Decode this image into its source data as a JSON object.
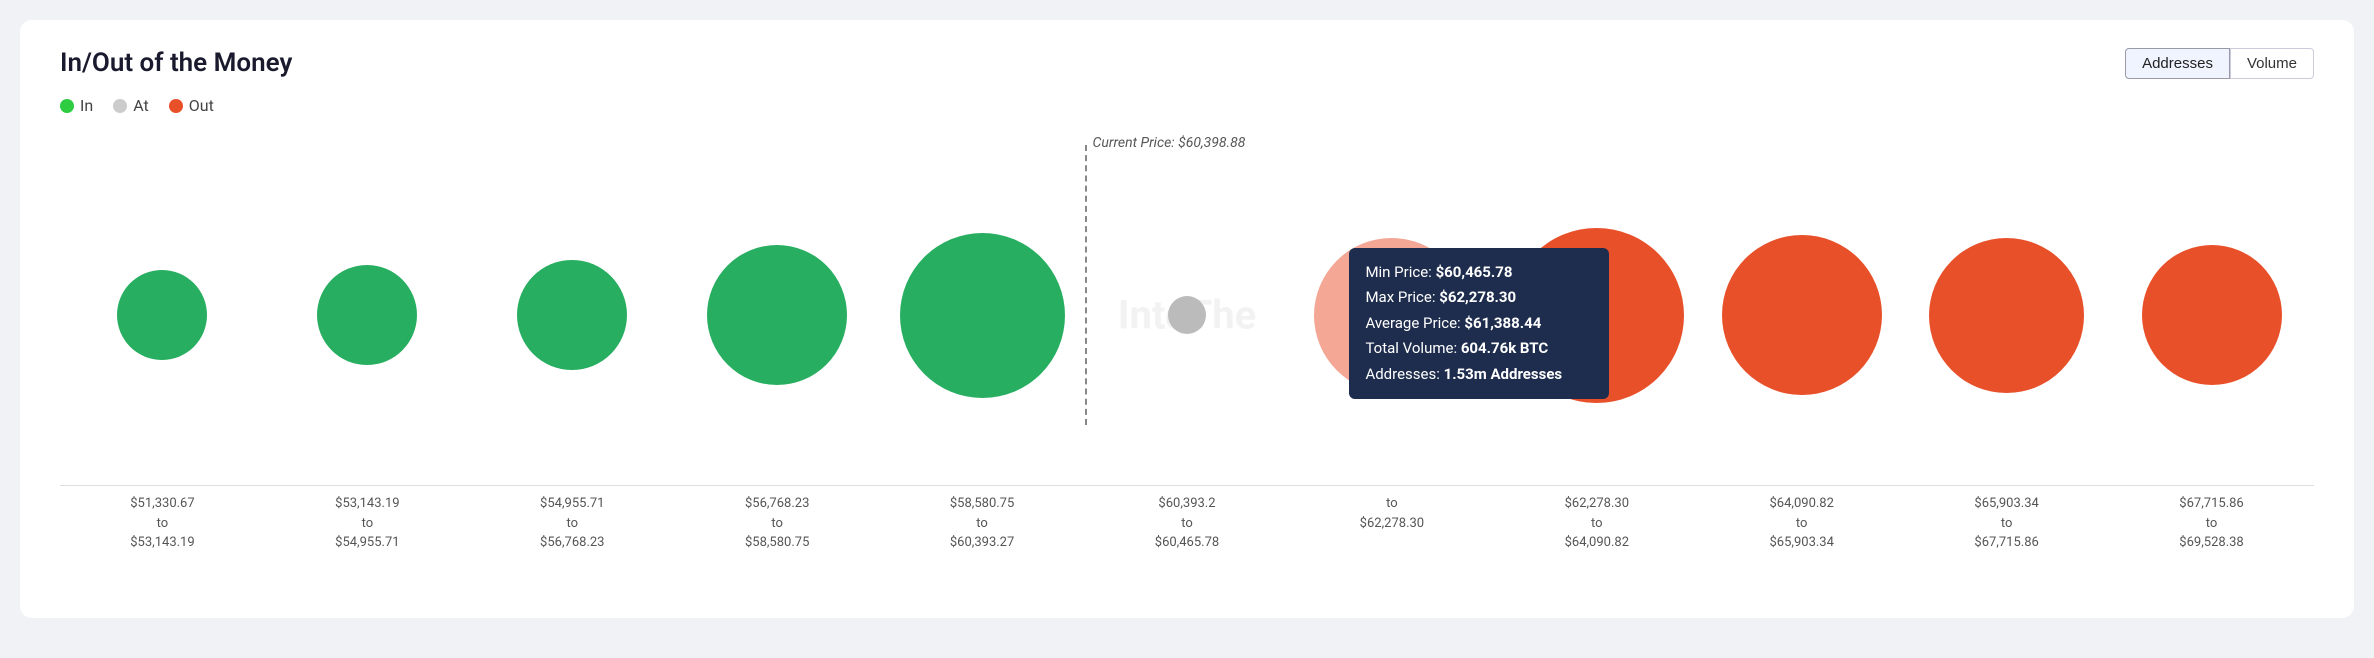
{
  "title": "In/Out of the Money",
  "legend": {
    "in_label": "In",
    "at_label": "At",
    "out_label": "Out"
  },
  "buttons": {
    "addresses_label": "Addresses",
    "volume_label": "Volume",
    "active": "Addresses"
  },
  "current_price": {
    "label": "Current Price: $60,398.88",
    "value": "$60,398.88"
  },
  "tooltip": {
    "min_price_label": "Min Price:",
    "min_price_value": "$60,465.78",
    "max_price_label": "Max Price:",
    "max_price_value": "$62,278.30",
    "avg_price_label": "Average Price:",
    "avg_price_value": "$61,388.44",
    "volume_label": "Total Volume:",
    "volume_value": "604.76k BTC",
    "addresses_label": "Addresses:",
    "addresses_value": "1.53m Addresses"
  },
  "watermark": "IntoThe",
  "columns": [
    {
      "from": "$51,330.67",
      "to": "$53,143.19",
      "type": "green",
      "size": 90
    },
    {
      "from": "$53,143.19",
      "to": "$54,955.71",
      "type": "green",
      "size": 100
    },
    {
      "from": "$54,955.71",
      "to": "$56,768.23",
      "type": "green",
      "size": 110
    },
    {
      "from": "$56,768.23",
      "to": "$58,580.75",
      "type": "green",
      "size": 140
    },
    {
      "from": "$58,580.75",
      "to": "$60,393.27",
      "type": "green",
      "size": 165
    },
    {
      "from": "$60,393.2",
      "to": "$60,465.78",
      "type": "gray",
      "size": 38
    },
    {
      "from": "$60,465.78",
      "to": "$62,278.30",
      "type": "red-faded",
      "size": 155
    },
    {
      "from": "$62,278.30",
      "to": "$64,090.82",
      "type": "red",
      "size": 175
    },
    {
      "from": "$64,090.82",
      "to": "$65,903.34",
      "type": "red",
      "size": 160
    },
    {
      "from": "$65,903.34",
      "to": "$67,715.86",
      "type": "red",
      "size": 155
    },
    {
      "from": "$67,715.86",
      "to": "$69,528.38",
      "type": "red",
      "size": 140
    }
  ]
}
